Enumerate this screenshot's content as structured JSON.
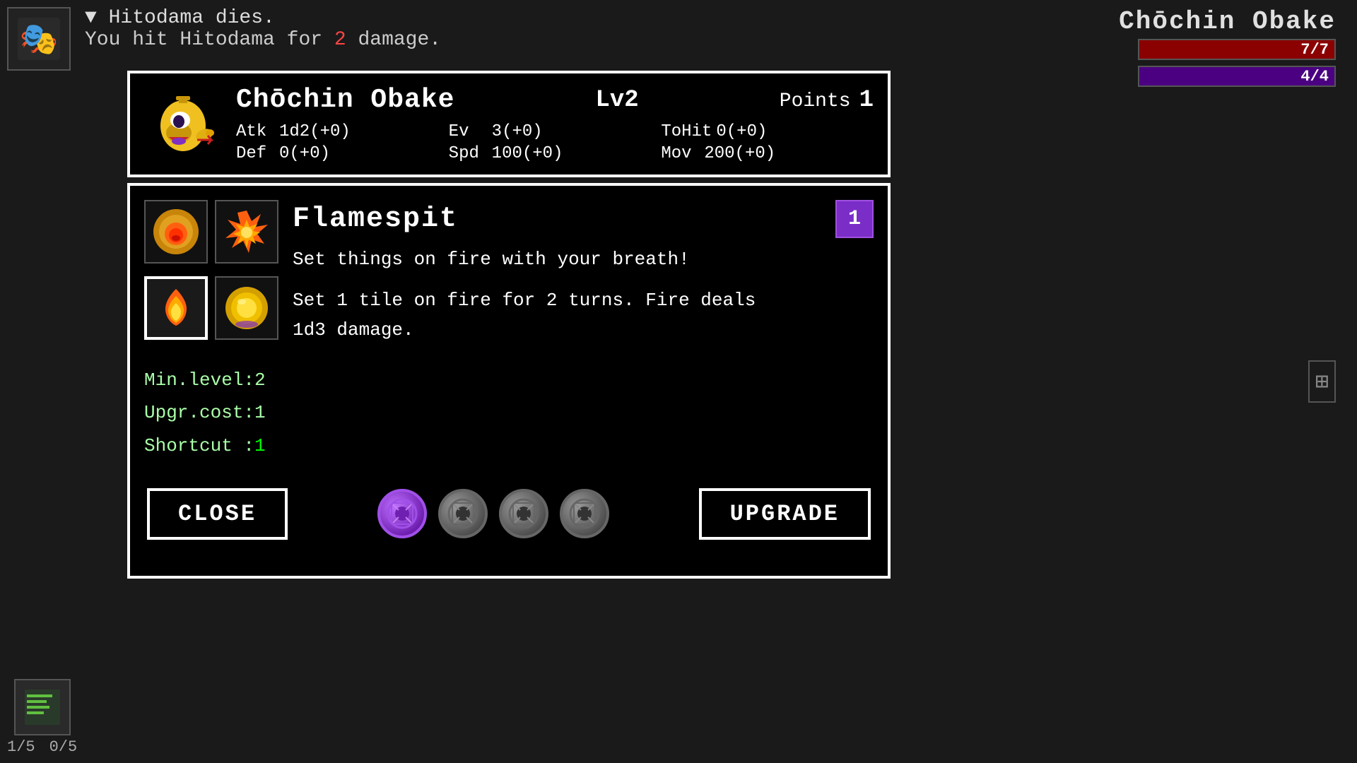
{
  "gameTitle": "Chōchin Obake",
  "topRight": {
    "charName": "Chōchin Obake",
    "hp": "7/7",
    "mp": "4/4"
  },
  "combatLog": {
    "line1": "▼ Hitodama dies.",
    "line2prefix": "You hit Hitodama for ",
    "damage": "2",
    "line2suffix": " damage."
  },
  "characterPanel": {
    "name": "Chōchin Obake",
    "level": "Lv2",
    "pointsLabel": "Points",
    "pointsValue": "1",
    "stats": {
      "atk": "1d2(+0)",
      "ev": "3(+0)",
      "toHit": "0(+0)",
      "def": "0(+0)",
      "spd": "100(+0)",
      "mov": "200(+0)"
    }
  },
  "skillPanel": {
    "skillName": "Flamespit",
    "skillLevel": "1",
    "descShort": "Set things on fire with your breath!",
    "descLong": "Set 1 tile on fire for 2 turns. Fire deals\n1d3 damage.",
    "minLevel": "Min.level:2",
    "upgrCost": "Upgr.cost:1",
    "shortcutLabel": "Shortcut :",
    "shortcutValue": "1"
  },
  "buttons": {
    "close": "CLOSE",
    "upgrade": "UPGRADE"
  },
  "orbs": {
    "active": 1,
    "total": 4
  },
  "inventory": {
    "item1": "📋",
    "counter1": "1/5",
    "counter2": "0/5"
  }
}
